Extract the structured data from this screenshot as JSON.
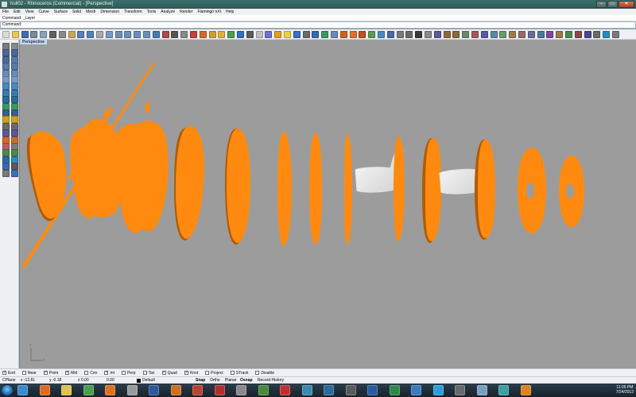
{
  "window": {
    "title": "hull02 - Rhinoceros (Commercial) - [Perspective]",
    "minimize": "–",
    "maximize": "□",
    "close": "✕"
  },
  "menu": [
    "File",
    "Edit",
    "View",
    "Curve",
    "Surface",
    "Solid",
    "Mesh",
    "Dimension",
    "Transform",
    "Tools",
    "Analyze",
    "Render",
    "Flamingo nXt",
    "Help"
  ],
  "command": {
    "history": "Command: _Layer",
    "prompt": "Command:",
    "value": ""
  },
  "viewport": {
    "label": "Perspective",
    "axis_x": "x",
    "axis_y": "y"
  },
  "osnap": {
    "items": [
      {
        "label": "End",
        "checked": true
      },
      {
        "label": "Near",
        "checked": false
      },
      {
        "label": "Point",
        "checked": true
      },
      {
        "label": "Mid",
        "checked": true
      },
      {
        "label": "Cen",
        "checked": false
      },
      {
        "label": "Int",
        "checked": true
      },
      {
        "label": "Perp",
        "checked": false
      },
      {
        "label": "Tan",
        "checked": false
      },
      {
        "label": "Quad",
        "checked": true
      },
      {
        "label": "Knot",
        "checked": true
      },
      {
        "label": "Project",
        "checked": false
      },
      {
        "label": "STrack",
        "checked": false
      },
      {
        "label": "Disable",
        "checked": false
      }
    ]
  },
  "status": {
    "cplane": "CPlane",
    "x": "x -12.81",
    "y": "y -0.18",
    "z": "z 0.00",
    "dist": "0.00",
    "layer": "Default",
    "snap": "Snap",
    "ortho": "Ortho",
    "planar": "Planar",
    "osnap": "Osnap",
    "record": "Record History"
  },
  "tray": {
    "time": "11:05 PM",
    "date": "7/24/2012"
  },
  "colors": {
    "hull": "#ff8a0f",
    "hull_dark": "#b35a00",
    "seat": "#eeeeee",
    "viewport_bg": "#9c9c9c"
  }
}
